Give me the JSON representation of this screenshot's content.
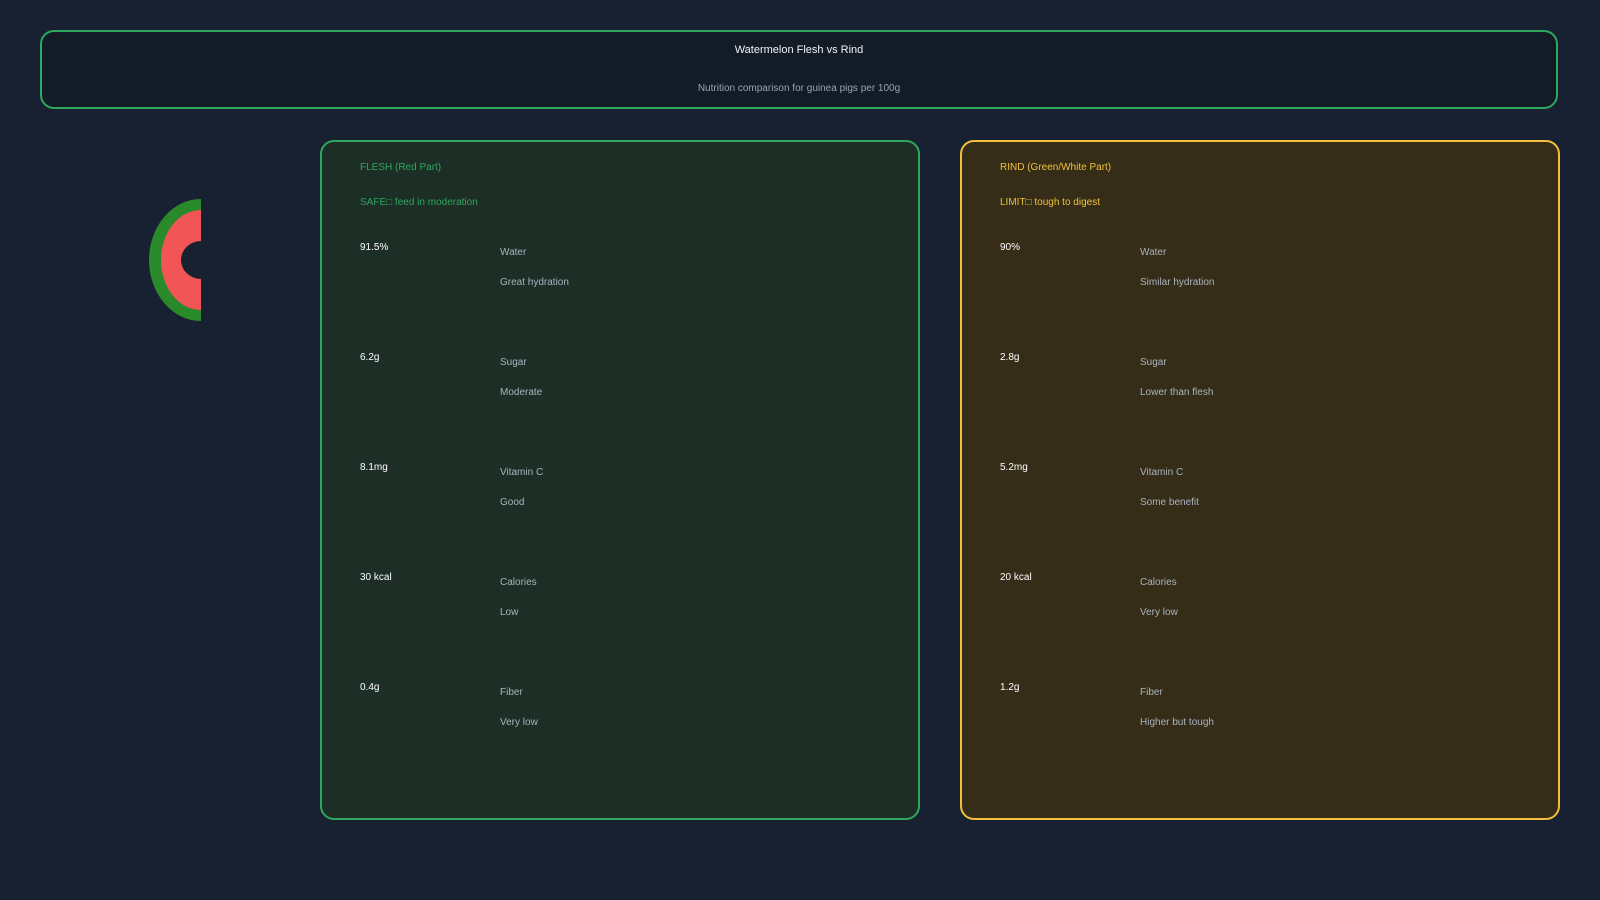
{
  "header": {
    "title": "Watermelon Flesh vs Rind",
    "subtitle": "Nutrition comparison for guinea pigs per 100g"
  },
  "icon": "watermelon-slice-icon",
  "colors": {
    "background": "#182132",
    "flesh_accent": "#2ea85f",
    "rind_accent": "#f0c03c",
    "melon_rind": "#2a8a2a",
    "melon_flesh": "#f25555"
  },
  "flesh": {
    "title": "FLESH (Red Part)",
    "verdict": "SAFE□ feed in moderation",
    "rows": [
      {
        "value": "91.5%",
        "nutrient": "Water",
        "note": "Great hydration"
      },
      {
        "value": "6.2g",
        "nutrient": "Sugar",
        "note": "Moderate"
      },
      {
        "value": "8.1mg",
        "nutrient": "Vitamin C",
        "note": "Good"
      },
      {
        "value": "30 kcal",
        "nutrient": "Calories",
        "note": "Low"
      },
      {
        "value": "0.4g",
        "nutrient": "Fiber",
        "note": "Very low"
      }
    ]
  },
  "rind": {
    "title": "RIND (Green/White Part)",
    "verdict": "LIMIT□ tough to digest",
    "rows": [
      {
        "value": "90%",
        "nutrient": "Water",
        "note": "Similar hydration"
      },
      {
        "value": "2.8g",
        "nutrient": "Sugar",
        "note": "Lower than flesh"
      },
      {
        "value": "5.2mg",
        "nutrient": "Vitamin C",
        "note": "Some benefit"
      },
      {
        "value": "20 kcal",
        "nutrient": "Calories",
        "note": "Very low"
      },
      {
        "value": "1.2g",
        "nutrient": "Fiber",
        "note": "Higher but tough"
      }
    ]
  }
}
